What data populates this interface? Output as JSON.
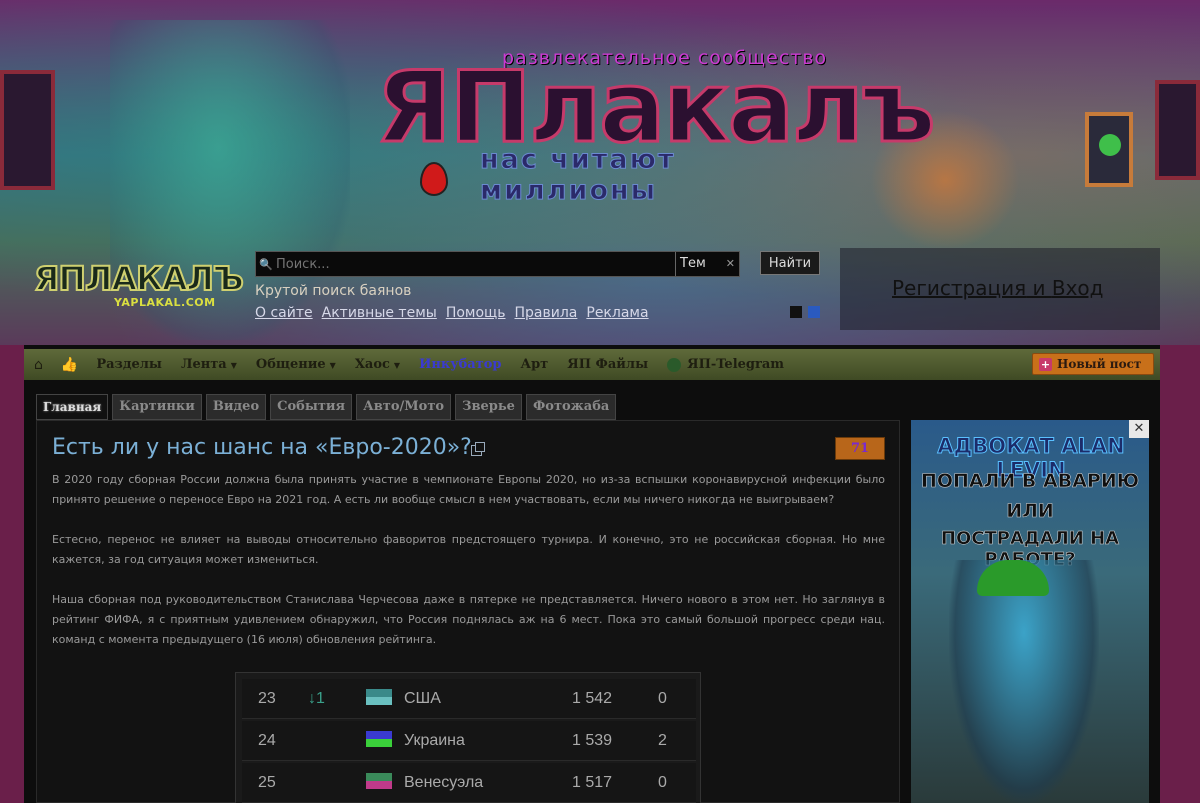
{
  "banner": {
    "tagline": "развлекательное сообщество",
    "logo_text": "ЯПлакалъ",
    "slogan": "нас читают миллионы",
    "site_logo_main": "ЯПЛАКАЛЪ",
    "site_logo_sub": "YAPLAKAL.COM"
  },
  "search": {
    "placeholder": "Поиск...",
    "scope": "Тем",
    "button_label": "Найти",
    "hint": "Крутой поиск баянов"
  },
  "top_links": [
    "О сайте",
    "Активные темы",
    "Помощь",
    "Правила",
    "Реклама"
  ],
  "auth": {
    "register_label": "Регистрация",
    "separator": "и",
    "login_label": "Вход"
  },
  "nav": {
    "items": [
      {
        "label": "Разделы",
        "caret": false
      },
      {
        "label": "Лента",
        "caret": true
      },
      {
        "label": "Общение",
        "caret": true
      },
      {
        "label": "Хаос",
        "caret": true
      },
      {
        "label": "Инкубатор",
        "caret": false
      },
      {
        "label": "Арт",
        "caret": false
      },
      {
        "label": "ЯП Файлы",
        "caret": false
      }
    ],
    "telegram_label": "ЯП-Telegram",
    "new_post_label": "Новый пост"
  },
  "tabs": [
    {
      "label": "Главная",
      "active": true
    },
    {
      "label": "Картинки",
      "active": false
    },
    {
      "label": "Видео",
      "active": false
    },
    {
      "label": "События",
      "active": false
    },
    {
      "label": "Авто/Мото",
      "active": false
    },
    {
      "label": "Зверье",
      "active": false
    },
    {
      "label": "Фотожаба",
      "active": false
    }
  ],
  "article": {
    "title": "Есть ли у нас шанс на «Евро-2020»?",
    "rating": "71",
    "paragraphs": [
      "В 2020 году сборная России должна была принять участие в чемпионате Европы 2020, но из-за вспышки коронавирусной инфекции было принято решение о переносе Евро на 2021 год. А есть ли вообще смысл в нем участвовать, если мы ничего никогда не выигрываем?",
      "Естесно, перенос не влияет на выводы относительно фаворитов предстоящего турнира. И конечно, это не российская сборная. Но мне кажется, за год ситуация может измениться.",
      "Наша сборная под руководительством Станислава Черчесова даже в пятерке не представляется. Ничего нового в этом нет. Но заглянув в рейтинг ФИФА, я с приятным удивлением обнаружил, что Россия поднялась аж на 6 мест. Пока это самый большой прогресс среди нац. команд с момента предыдущего (16 июля) обновления рейтинга."
    ],
    "fifa_rows": [
      {
        "rank": "23",
        "move": "↓1",
        "country": "США",
        "points": "1 542",
        "prev": "0",
        "flag_colors": [
          "#3a8a8a",
          "#6ac0c0"
        ]
      },
      {
        "rank": "24",
        "move": "",
        "country": "Украина",
        "points": "1 539",
        "prev": "2",
        "flag_colors": [
          "#3a3ad0",
          "#3ad03a"
        ]
      },
      {
        "rank": "25",
        "move": "",
        "country": "Венесуэла",
        "points": "1 517",
        "prev": "0",
        "flag_colors": [
          "#3a8a5a",
          "#c03a8a"
        ]
      }
    ]
  },
  "ad": {
    "title": "АДВОКАТ ALAN LEVIN",
    "line1": "ПОПАЛИ В АВАРИЮ",
    "line2": "ИЛИ",
    "line3": "ПОСТРАДАЛИ НА РАБОТЕ?",
    "close_label": "✕"
  }
}
